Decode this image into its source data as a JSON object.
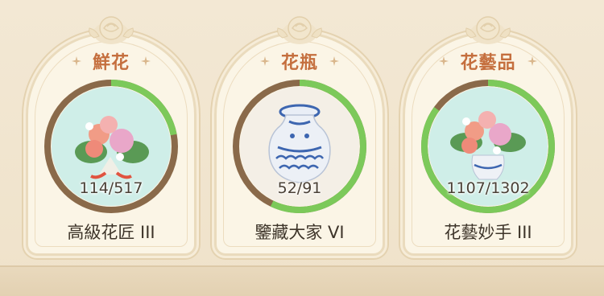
{
  "cards": [
    {
      "title": "鮮花",
      "progress": "114/517",
      "progress_value": 114,
      "progress_total": 517,
      "rank": "高級花匠 III",
      "icon": "bouquet-icon"
    },
    {
      "title": "花瓶",
      "progress": "52/91",
      "progress_value": 52,
      "progress_total": 91,
      "rank": "鑒藏大家 VI",
      "icon": "vase-icon"
    },
    {
      "title": "花藝品",
      "progress": "1107/1302",
      "progress_value": 1107,
      "progress_total": 1302,
      "rank": "花藝妙手 III",
      "icon": "flower-arrangement-icon"
    }
  ],
  "colors": {
    "title": "#c56f3e",
    "ring_track": "#8a6a4a",
    "ring_progress": "#7cc95a",
    "card_bg": "#fbf5e6"
  }
}
